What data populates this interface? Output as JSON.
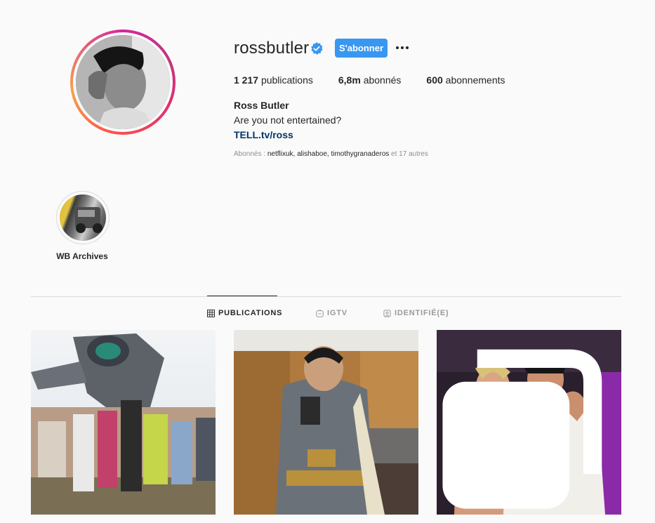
{
  "profile": {
    "username": "rossbutler",
    "follow_label": "S'abonner",
    "stats": {
      "posts_count": "1 217",
      "posts_label": "publications",
      "followers_count": "6,8m",
      "followers_label": "abonnés",
      "following_count": "600",
      "following_label": "abonnements"
    },
    "full_name": "Ross Butler",
    "bio": "Are you not entertained?",
    "link": "TELL.tv/ross",
    "followed_by_prefix": "Abonnés :",
    "followed_by_names": "netflixuk, alishaboe, timothygranaderos",
    "followed_by_suffix": "et 17 autres"
  },
  "highlights": [
    {
      "label": "WB Archives"
    }
  ],
  "tabs": [
    {
      "label": "PUBLICATIONS",
      "icon": "grid-icon",
      "active": true
    },
    {
      "label": "IGTV",
      "icon": "igtv-icon",
      "active": false
    },
    {
      "label": "IDENTIFIÉ(E)",
      "icon": "tagged-icon",
      "active": false
    }
  ],
  "posts": [
    {
      "icon": "photo",
      "multi": false
    },
    {
      "icon": "photo",
      "multi": false
    },
    {
      "icon": "photo",
      "multi": true
    }
  ],
  "colors": {
    "accent": "#3897f0",
    "link": "#003569",
    "verified": "#3897f0"
  }
}
